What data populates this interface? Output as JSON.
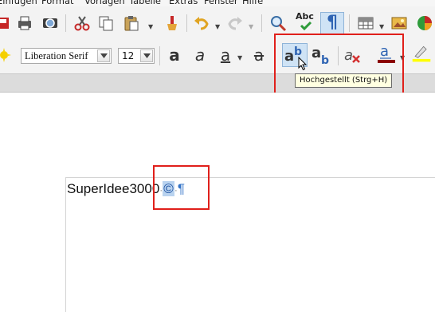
{
  "menubar": {
    "items": [
      "Einfügen",
      "Format",
      "Vorlagen",
      "Tabelle",
      "Extras",
      "Fenster",
      "Hilfe"
    ]
  },
  "toolbar_standard": {
    "icons": [
      "print-icon",
      "print-preview-icon",
      "cut-icon",
      "copy-icon",
      "paste-icon",
      "clone-formatting-icon",
      "undo-icon",
      "redo-icon",
      "find-replace-icon",
      "spellcheck-icon",
      "formatting-marks-icon",
      "insert-table-icon",
      "insert-image-icon",
      "insert-chart-icon"
    ],
    "spellcheck_label": "Abc",
    "formatting_marks_active": true
  },
  "toolbar_formatting": {
    "font_name": "Liberation Serif",
    "font_size": "12",
    "bold_label": "a",
    "italic_label": "a",
    "underline_label": "a",
    "strike_label": "a",
    "superscript_label": "ab",
    "subscript_label": "ab",
    "clear_label": "a",
    "font_color_label": "a",
    "font_color": "#8b0000",
    "highlight_color": "#ffff00",
    "hovered_button": "superscript"
  },
  "tooltip": {
    "text": "Hochgestellt (Strg+H)"
  },
  "document": {
    "text_main": "SuperIdee3000",
    "space_mark": "·",
    "selected_char": "©",
    "space_mark_2": "·",
    "paragraph_mark": "¶"
  },
  "colors": {
    "annotation_red": "#e0201b",
    "selection": "#b9d3ef",
    "toolbar_bg": "#f3f3f3"
  }
}
